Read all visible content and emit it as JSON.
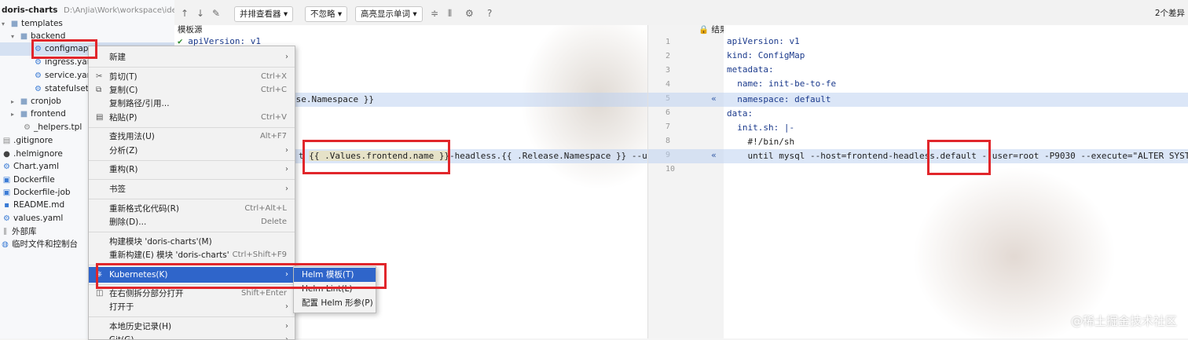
{
  "tree": {
    "project": "doris-charts",
    "project_path": "D:\\AnJia\\Work\\workspace\\ide",
    "items": [
      {
        "label": "templates",
        "icon": "folder-icon",
        "expanded": true
      },
      {
        "label": "backend",
        "icon": "folder-icon",
        "expanded": true
      },
      {
        "label": "configmap.",
        "icon": "gear-icon"
      },
      {
        "label": "ingress.yan",
        "icon": "gear-icon"
      },
      {
        "label": "service.yam",
        "icon": "gear-icon"
      },
      {
        "label": "statefulset.",
        "icon": "gear-icon"
      },
      {
        "label": "cronjob",
        "icon": "folder-icon",
        "expanded": false
      },
      {
        "label": "frontend",
        "icon": "folder-icon",
        "expanded": false
      },
      {
        "label": "_helpers.tpl",
        "icon": "file-icon"
      },
      {
        "label": ".gitignore",
        "icon": "file-icon"
      },
      {
        "label": ".helmignore",
        "icon": "file-icon"
      },
      {
        "label": "Chart.yaml",
        "icon": "gear-icon"
      },
      {
        "label": "Dockerfile",
        "icon": "file-icon"
      },
      {
        "label": "Dockerfile-job",
        "icon": "file-icon"
      },
      {
        "label": "README.md",
        "icon": "markdown-icon"
      },
      {
        "label": "values.yaml",
        "icon": "gear-icon"
      },
      {
        "label": "外部库",
        "icon": "library-icon"
      },
      {
        "label": "临时文件和控制台",
        "icon": "console-icon"
      }
    ]
  },
  "toolbar": {
    "viewer": "并排查看器",
    "ignore": "不忽略",
    "highlight": "高亮显示单词",
    "help": "?",
    "diff_count": "2个差异"
  },
  "left_pane": {
    "title": "模板源",
    "lines": [
      {
        "num": "1",
        "text": "apiVersion: v1"
      },
      {
        "num": "5",
        "text": "ase.Namespace }}"
      },
      {
        "num": "9",
        "text_prefix": "t ",
        "highlight": "{{ .Values.frontend.name }}",
        "text_suffix": "-headless.{{ .Release.Namespace }} --us"
      }
    ]
  },
  "right_pane": {
    "title": "结果",
    "lines": [
      "apiVersion: v1",
      "kind: ConfigMap",
      "metadata:",
      "  name: init-be-to-fe",
      "  namespace: default",
      "data:",
      "  init.sh: |-",
      "    #!/bin/sh",
      "    until mysql --host=frontend-headless.default --user=root -P9030 --execute=\"ALTER SYST"
    ],
    "gutter_numbers": [
      "1",
      "2",
      "3",
      "4",
      "5",
      "6",
      "7",
      "8",
      "9",
      "10"
    ]
  },
  "menu": {
    "items": [
      {
        "label": "新建",
        "shortcut": "",
        "submenu": true
      },
      {
        "label": "剪切(T)",
        "shortcut": "Ctrl+X",
        "icon": "cut-icon"
      },
      {
        "label": "复制(C)",
        "shortcut": "Ctrl+C",
        "icon": "copy-icon"
      },
      {
        "label": "复制路径/引用...",
        "shortcut": ""
      },
      {
        "label": "粘贴(P)",
        "shortcut": "Ctrl+V",
        "icon": "paste-icon"
      },
      {
        "label": "查找用法(U)",
        "shortcut": "Alt+F7"
      },
      {
        "label": "分析(Z)",
        "shortcut": "",
        "submenu": true
      },
      {
        "label": "重构(R)",
        "shortcut": "",
        "submenu": true
      },
      {
        "label": "书签",
        "shortcut": "",
        "submenu": true
      },
      {
        "label": "重新格式化代码(R)",
        "shortcut": "Ctrl+Alt+L"
      },
      {
        "label": "删除(D)...",
        "shortcut": "Delete"
      },
      {
        "label": "构建模块 'doris-charts'(M)",
        "shortcut": ""
      },
      {
        "label": "重新构建(E) 模块 'doris-charts'",
        "shortcut": "Ctrl+Shift+F9"
      },
      {
        "label": "Kubernetes(K)",
        "shortcut": "",
        "submenu": true,
        "selected": true
      },
      {
        "label": "在右侧拆分部分打开",
        "shortcut": "Shift+Enter"
      },
      {
        "label": "打开于",
        "shortcut": "",
        "submenu": true
      },
      {
        "label": "本地历史记录(H)",
        "shortcut": "",
        "submenu": true
      },
      {
        "label": "Git(G)",
        "shortcut": "",
        "submenu": true
      }
    ]
  },
  "submenu": {
    "items": [
      "Helm 模板(T)",
      "Helm Lint(L)",
      "配置 Helm 形参(P)"
    ]
  },
  "watermark": "@稀土掘金技术社区"
}
